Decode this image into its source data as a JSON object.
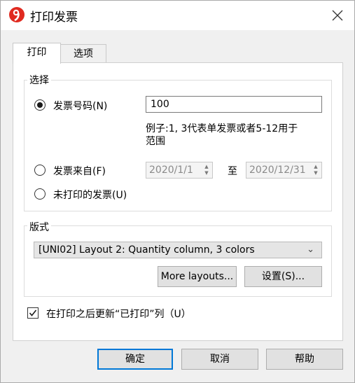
{
  "window": {
    "title": "打印发票"
  },
  "tabs": [
    {
      "label": "打印"
    },
    {
      "label": "选项"
    }
  ],
  "selection": {
    "group_label": "选择",
    "invoice_number_label": "发票号码(N)",
    "invoice_number_value": "100",
    "hint_line1": "例子:1, 3代表单发票或者5-12用于",
    "hint_line2": "范围",
    "invoice_from_label": "发票来自(F)",
    "date_from": "2020/1/1",
    "to_label": "至",
    "date_to": "2020/12/31",
    "unprinted_label": "未打印的发票(U)",
    "selected_option": "invoice_number"
  },
  "layout": {
    "group_label": "版式",
    "selected": "[UNI02] Layout 2: Quantity column, 3 colors",
    "more_layouts_label": "More layouts...",
    "settings_label": "设置(S)..."
  },
  "update_printed": {
    "label": "在打印之后更新“已打印”列（U）",
    "checked": true
  },
  "buttons": {
    "ok": "确定",
    "cancel": "取消",
    "help": "帮助"
  },
  "colors": {
    "accent": "#0078d7",
    "icon_red": "#e02a20"
  },
  "icons": {
    "app": "app-logo-icon",
    "close": "close-icon"
  }
}
